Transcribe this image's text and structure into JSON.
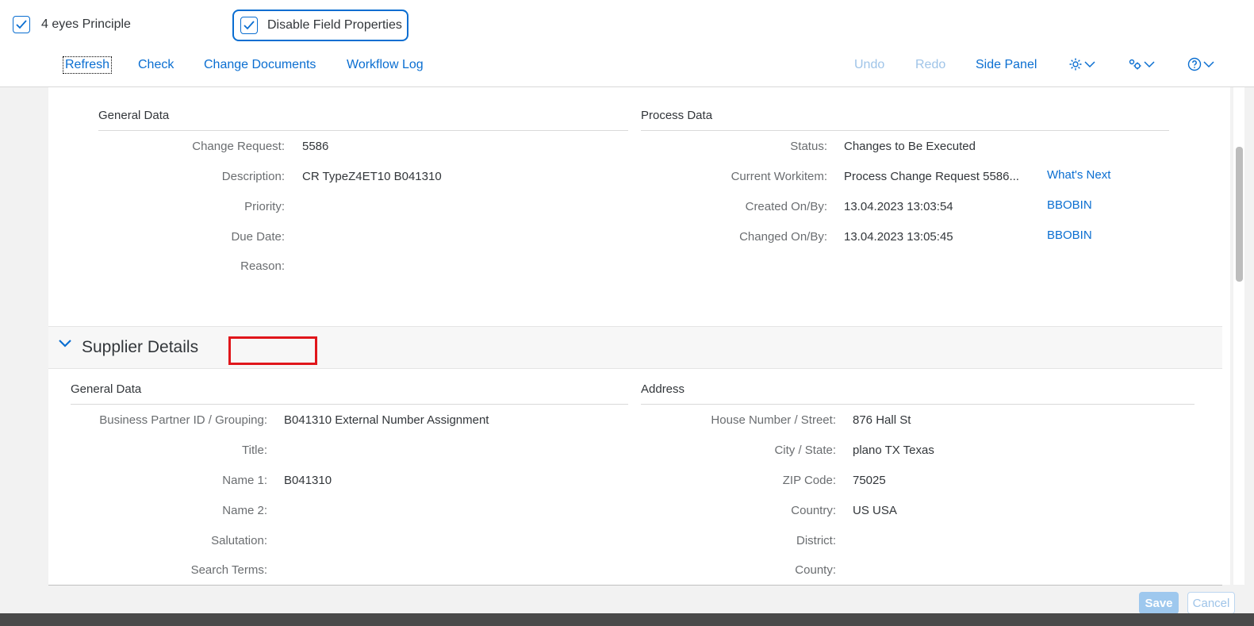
{
  "checkboxes": {
    "four_eyes": "4 eyes Principle",
    "disable_field_props": "Disable Field Properties"
  },
  "toolbar": {
    "refresh": "Refresh",
    "check": "Check",
    "change_documents": "Change Documents",
    "workflow_log": "Workflow Log",
    "undo": "Undo",
    "redo": "Redo",
    "side_panel": "Side Panel"
  },
  "general_data": {
    "title": "General Data",
    "rows": [
      {
        "label": "Change Request:",
        "value": "5586"
      },
      {
        "label": "Description:",
        "value": "CR TypeZ4ET10 B041310"
      },
      {
        "label": "Priority:",
        "value": ""
      },
      {
        "label": "Due Date:",
        "value": ""
      },
      {
        "label": "Reason:",
        "value": ""
      }
    ]
  },
  "process_data": {
    "title": "Process Data",
    "rows": [
      {
        "label": "Status:",
        "value": "Changes to Be Executed",
        "link": ""
      },
      {
        "label": "Current Workitem:",
        "value": "Process Change Request 5586...",
        "link": "What's Next"
      },
      {
        "label": "Created On/By:",
        "value": "13.04.2023 13:03:54",
        "link": "BBOBIN"
      },
      {
        "label": "Changed On/By:",
        "value": "13.04.2023 13:05:45",
        "link": "BBOBIN"
      }
    ]
  },
  "supplier_details": {
    "title": "Supplier Details",
    "general": {
      "title": "General Data",
      "rows": [
        {
          "label": "Business Partner ID / Grouping:",
          "value": "B041310 External Number Assignment"
        },
        {
          "label": "Title:",
          "value": ""
        },
        {
          "label": "Name 1:",
          "value": "B041310"
        },
        {
          "label": "Name 2:",
          "value": ""
        },
        {
          "label": "Salutation:",
          "value": ""
        },
        {
          "label": "Search Terms:",
          "value": ""
        }
      ]
    },
    "address": {
      "title": "Address",
      "rows": [
        {
          "label": "House Number / Street:",
          "value": "876 Hall St"
        },
        {
          "label": "City / State:",
          "value": "plano TX Texas"
        },
        {
          "label": "ZIP Code:",
          "value": "75025"
        },
        {
          "label": "Country:",
          "value": "US USA"
        },
        {
          "label": "District:",
          "value": ""
        },
        {
          "label": "County:",
          "value": ""
        }
      ]
    }
  },
  "footer": {
    "save": "Save",
    "cancel": "Cancel"
  },
  "colors": {
    "accent": "#0a6ed1",
    "highlight": "#e0161b"
  },
  "icons": [
    "checkmark-icon",
    "settings-icon",
    "personalize-icon",
    "help-icon",
    "chevron-down-icon"
  ]
}
